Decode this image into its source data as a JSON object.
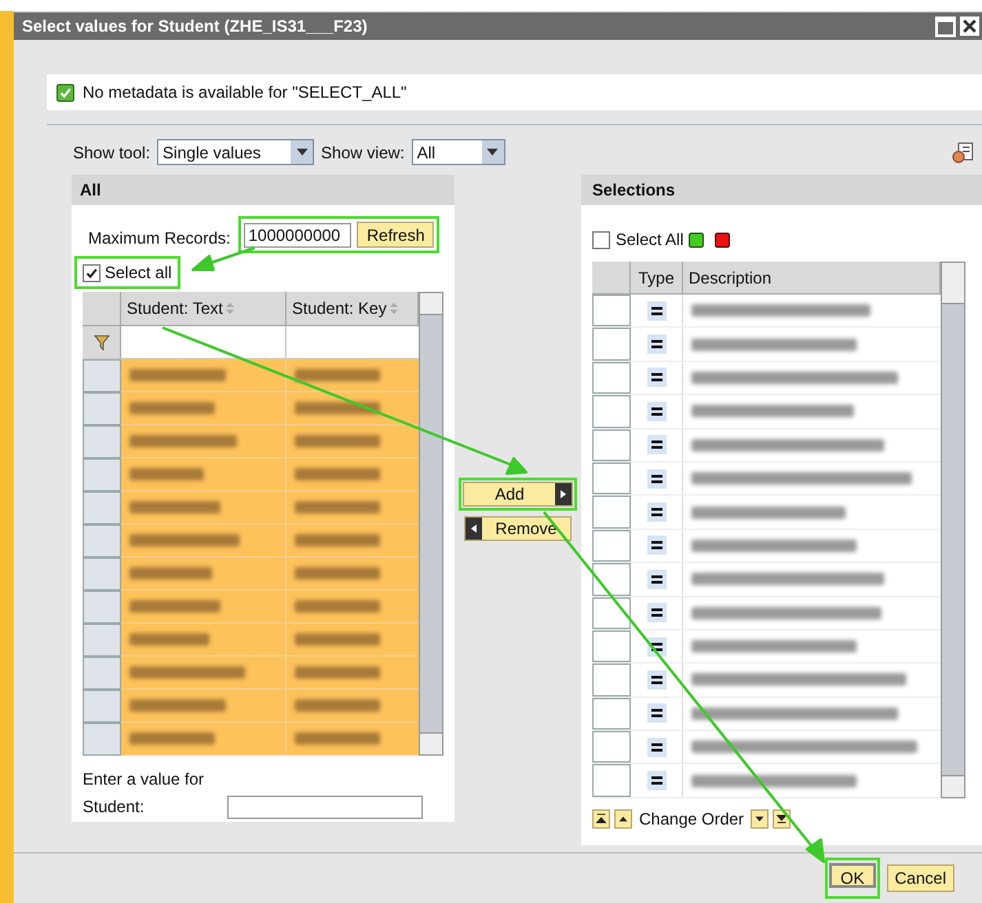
{
  "window": {
    "title": "Select values for Student (ZHE_IS31___F23)"
  },
  "message": {
    "text": "No metadata is available for \"SELECT_ALL\"",
    "checked": true
  },
  "toolbar": {
    "show_tool": {
      "label": "Show tool:",
      "value": "Single values"
    },
    "show_view": {
      "label": "Show view:",
      "value": "All"
    }
  },
  "left_panel": {
    "title": "All",
    "max_records": {
      "label": "Maximum Records:",
      "value": "1000000000"
    },
    "refresh_button": "Refresh",
    "select_all": {
      "label": "Select all",
      "checked": true
    },
    "columns": [
      "Student: Text",
      "Student: Key"
    ],
    "rows": [
      {
        "kind": "blurred",
        "selected": true
      },
      {
        "kind": "blurred",
        "selected": true
      },
      {
        "kind": "blurred",
        "selected": true
      },
      {
        "kind": "blurred",
        "selected": true
      },
      {
        "kind": "blurred",
        "selected": true
      },
      {
        "kind": "blurred",
        "selected": true
      },
      {
        "kind": "blurred",
        "selected": true
      },
      {
        "kind": "blurred",
        "selected": true
      },
      {
        "kind": "blurred",
        "selected": true
      },
      {
        "kind": "blurred",
        "selected": true
      },
      {
        "kind": "blurred",
        "selected": true
      },
      {
        "kind": "blurred",
        "selected": true
      }
    ],
    "value_entry": {
      "label_line1": "Enter a value for",
      "label_line2": "Student:"
    }
  },
  "transfer": {
    "add": "Add",
    "remove": "Remove"
  },
  "right_panel": {
    "title": "Selections",
    "select_all": {
      "label": "Select All",
      "checked": false
    },
    "columns": [
      "Type",
      "Description"
    ],
    "rows": [
      {
        "kind": "blurred"
      },
      {
        "kind": "blurred"
      },
      {
        "kind": "blurred"
      },
      {
        "kind": "blurred"
      },
      {
        "kind": "blurred"
      },
      {
        "kind": "blurred"
      },
      {
        "kind": "blurred"
      },
      {
        "kind": "blurred"
      },
      {
        "kind": "blurred"
      },
      {
        "kind": "blurred"
      },
      {
        "kind": "blurred"
      },
      {
        "kind": "blurred"
      },
      {
        "kind": "blurred"
      },
      {
        "kind": "blurred"
      },
      {
        "kind": "blurred"
      }
    ],
    "change_order": "Change Order"
  },
  "buttons": [
    {
      "label": "OK",
      "kind": "primary"
    },
    {
      "label": "Cancel",
      "kind": "secondary"
    }
  ]
}
